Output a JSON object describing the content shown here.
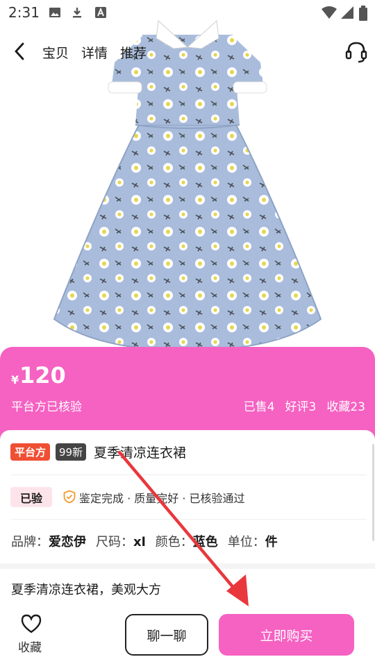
{
  "status_bar": {
    "time": "2:31",
    "left_icons": [
      "image-icon",
      "download-icon",
      "text-icon"
    ],
    "right_icons": [
      "wifi-icon",
      "signal-icon",
      "battery-icon"
    ]
  },
  "nav": {
    "tabs": [
      "宝贝",
      "详情",
      "推荐"
    ]
  },
  "price": {
    "currency": "¥",
    "value": "120",
    "note": "平台方已核验",
    "stats": [
      "已售4",
      "好评3",
      "收藏23"
    ]
  },
  "product": {
    "badge_platform": "平台方",
    "badge_condition": "99新",
    "title": "夏季清凉连衣裙",
    "verified_badge": "已验",
    "verified_detail": "鉴定完成 · 质量完好 · 已核验通过",
    "specs": [
      {
        "label": "品牌：",
        "value": "爱恋伊"
      },
      {
        "label": "尺码：",
        "value": "xl"
      },
      {
        "label": "颜色：",
        "value": "蓝色"
      },
      {
        "label": "单位：",
        "value": "件"
      }
    ],
    "description": "夏季清凉连衣裙，美观大方"
  },
  "bottom_bar": {
    "favorite_label": "收藏",
    "chat_label": "聊一聊",
    "buy_label": "立即购买"
  },
  "colors": {
    "accent": "#f562c2",
    "platform_badge": "#ef4f33",
    "annotation_arrow": "#e8383d"
  }
}
